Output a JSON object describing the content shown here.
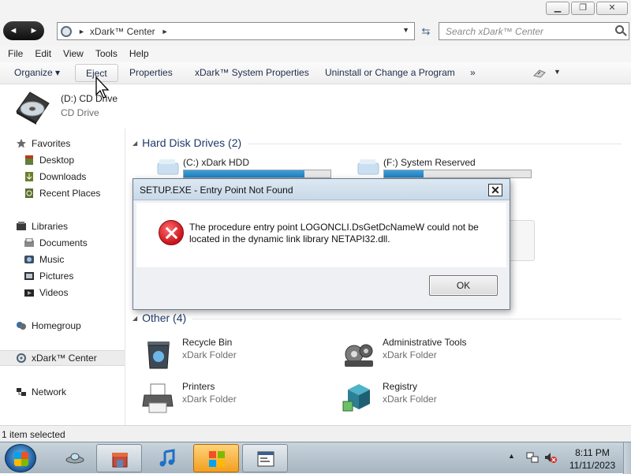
{
  "window": {
    "minimize_glyph": "▁",
    "maximize_glyph": "❐",
    "close_glyph": "✕"
  },
  "address": {
    "location": "xDark™ Center",
    "sep_glyph": "►",
    "end_glyph": "►",
    "dropdown_glyph": "▼",
    "refresh_glyph": "⇆",
    "search_placeholder": "Search xDark™ Center"
  },
  "nav_buttons": {
    "back": "◄",
    "forward": "►"
  },
  "menu": [
    "File",
    "Edit",
    "View",
    "Tools",
    "Help"
  ],
  "commands": {
    "organize": "Organize ▾",
    "eject": "Eject",
    "properties": "Properties",
    "system_properties": "xDark™ System Properties",
    "uninstall": "Uninstall or Change a Program",
    "more": "»",
    "more_drop": "▼"
  },
  "details": {
    "title": "(D:) CD Drive",
    "subtitle": "CD Drive"
  },
  "nav": {
    "favorites": "Favorites",
    "desktop": "Desktop",
    "downloads": "Downloads",
    "recent": "Recent Places",
    "libraries": "Libraries",
    "documents": "Documents",
    "music": "Music",
    "pictures": "Pictures",
    "videos": "Videos",
    "homegroup": "Homegroup",
    "center": "xDark™ Center",
    "network": "Network"
  },
  "groups": {
    "hard_disks": {
      "title": "Hard Disk Drives (2)",
      "chevron": "◢"
    },
    "other": {
      "title": "Other (4)",
      "chevron": "◢"
    }
  },
  "drives": [
    {
      "name": "(C:) xDark HDD",
      "used_fraction": 0.82
    },
    {
      "name": "(F:) System Reserved",
      "used_fraction": 0.27
    }
  ],
  "other_items": [
    {
      "name": "Recycle Bin",
      "type": "xDark Folder"
    },
    {
      "name": "Administrative Tools",
      "type": "xDark Folder"
    },
    {
      "name": "Printers",
      "type": "xDark Folder"
    },
    {
      "name": "Registry",
      "type": "xDark Folder"
    }
  ],
  "status": {
    "text": "1 item selected"
  },
  "dialog": {
    "title": "SETUP.EXE - Entry Point Not Found",
    "close_glyph": "✕",
    "message": "The procedure entry point LOGONCLI.DsGetDcNameW could not be located in the dynamic link library NETAPI32.dll.",
    "ok": "OK"
  },
  "taskbar": {
    "time": "8:11 PM",
    "date": "11/11/2023",
    "tray_up_glyph": "▲"
  },
  "colors": {
    "accent": "#1f7fc0",
    "error": "#c8141b",
    "group_title": "#1e3a6a"
  }
}
